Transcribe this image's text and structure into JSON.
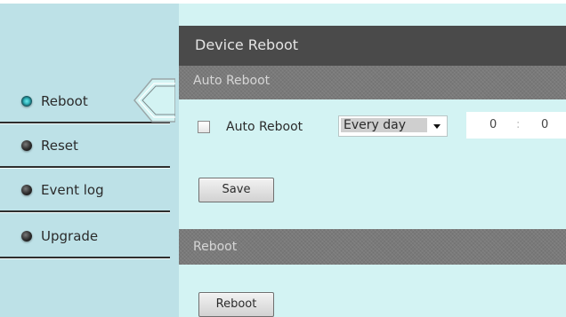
{
  "sidebar": {
    "items": [
      {
        "label": "Reboot",
        "icon": "bullet-active-icon"
      },
      {
        "label": "Reset",
        "icon": "bullet-icon"
      },
      {
        "label": "Event log",
        "icon": "bullet-icon"
      },
      {
        "label": "Upgrade",
        "icon": "bullet-icon"
      }
    ],
    "active_index": 0
  },
  "header": {
    "title": "Device Reboot"
  },
  "auto_reboot": {
    "section_title": "Auto Reboot",
    "checkbox_label": "Auto Reboot",
    "checked": false,
    "schedule_selected": "Every day",
    "hour": "0",
    "separator": ":",
    "minute": "0",
    "save_label": "Save"
  },
  "reboot": {
    "section_title": "Reboot",
    "button_label": "Reboot"
  },
  "colors": {
    "sidebar_bg": "#bde1e7",
    "content_bg": "#d3f3f3",
    "title_bar": "#4a4a4a",
    "section_bar": "#7a7a7a",
    "active_bullet": "#33b6bd"
  }
}
